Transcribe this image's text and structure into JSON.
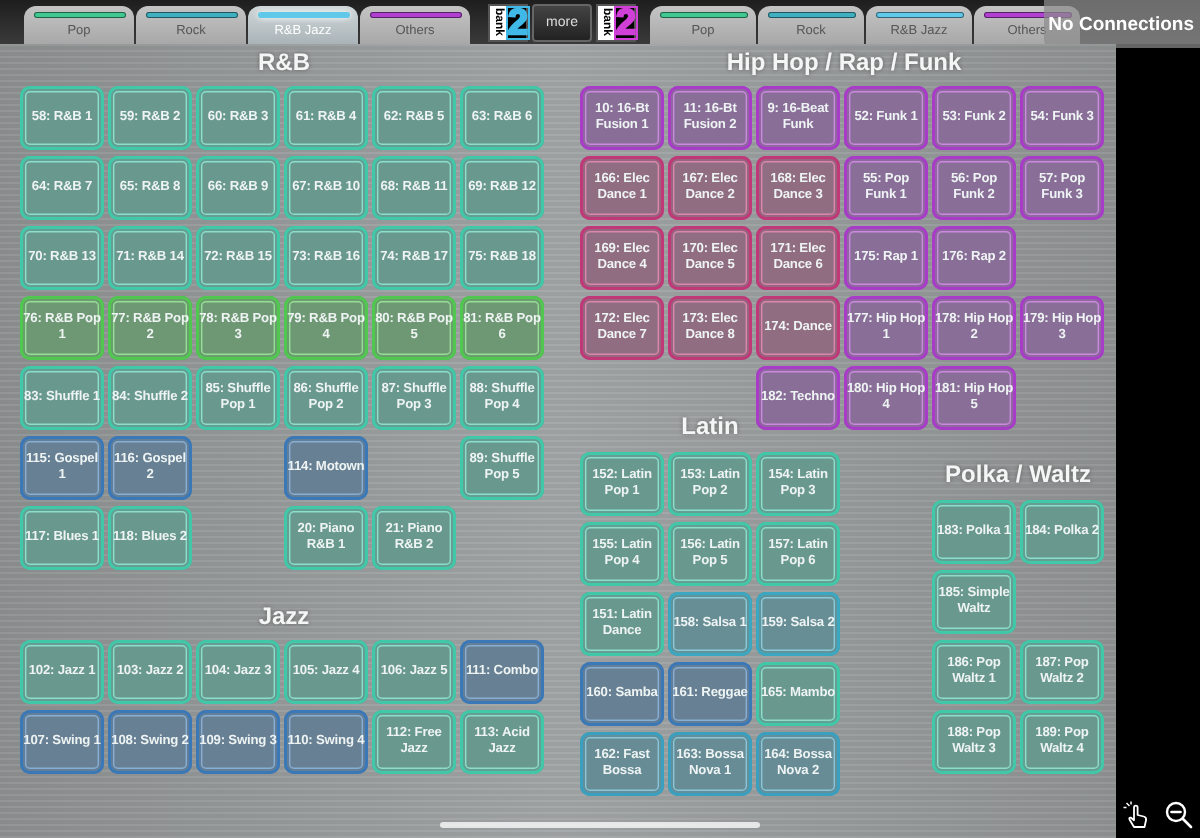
{
  "tabs_left": [
    {
      "label": "Pop",
      "color": "#40c890",
      "selected": false
    },
    {
      "label": "Rock",
      "color": "#40b0c0",
      "selected": false
    },
    {
      "label": "R&B Jazz",
      "color": "#60c8e8",
      "selected": true
    },
    {
      "label": "Others",
      "color": "#b040d0",
      "selected": false
    }
  ],
  "banks": [
    {
      "label": "bank",
      "number": "2",
      "color": "#40b8e8"
    },
    {
      "label": "bank",
      "number": "2",
      "color": "#d040d8"
    }
  ],
  "more_button": "more",
  "tabs_right": [
    {
      "label": "Pop",
      "color": "#40c890",
      "selected": false
    },
    {
      "label": "Rock",
      "color": "#40b0c0",
      "selected": false
    },
    {
      "label": "R&B Jazz",
      "color": "#60c8e8",
      "selected": false
    },
    {
      "label": "Others",
      "color": "#b040d0",
      "selected": false
    }
  ],
  "status": "No Connections",
  "left_panel": {
    "sections": [
      {
        "title": "R&B",
        "rows": [
          [
            {
              "label": "58: R&B 1",
              "color": "#40c8a8"
            },
            {
              "label": "59: R&B 2",
              "color": "#40c8a8"
            },
            {
              "label": "60: R&B 3",
              "color": "#40c8a8"
            },
            {
              "label": "61: R&B 4",
              "color": "#40c8a8"
            },
            {
              "label": "62: R&B 5",
              "color": "#40c8a8"
            },
            {
              "label": "63: R&B 6",
              "color": "#40c8a8"
            }
          ],
          [
            {
              "label": "64: R&B 7",
              "color": "#40c8a8"
            },
            {
              "label": "65: R&B 8",
              "color": "#40c8a8"
            },
            {
              "label": "66: R&B 9",
              "color": "#40c8a8"
            },
            {
              "label": "67: R&B 10",
              "color": "#40c8a8"
            },
            {
              "label": "68: R&B 11",
              "color": "#40c8a8"
            },
            {
              "label": "69: R&B 12",
              "color": "#40c8a8"
            }
          ],
          [
            {
              "label": "70: R&B 13",
              "color": "#40c8a8"
            },
            {
              "label": "71: R&B 14",
              "color": "#40c8a8"
            },
            {
              "label": "72: R&B 15",
              "color": "#40c8a8"
            },
            {
              "label": "73: R&B 16",
              "color": "#40c8a8"
            },
            {
              "label": "74: R&B 17",
              "color": "#40c8a8"
            },
            {
              "label": "75: R&B 18",
              "color": "#40c8a8"
            }
          ],
          [
            {
              "label": "76: R&B Pop 1",
              "color": "#50c850"
            },
            {
              "label": "77: R&B Pop 2",
              "color": "#50c850"
            },
            {
              "label": "78: R&B Pop 3",
              "color": "#50c850"
            },
            {
              "label": "79: R&B Pop 4",
              "color": "#50c850"
            },
            {
              "label": "80: R&B Pop 5",
              "color": "#50c850"
            },
            {
              "label": "81: R&B Pop 6",
              "color": "#50c850"
            }
          ],
          [
            {
              "label": "83: Shuffle 1",
              "color": "#40c8a8"
            },
            {
              "label": "84: Shuffle 2",
              "color": "#40c8a8"
            },
            {
              "label": "85: Shuffle Pop 1",
              "color": "#40c8a8"
            },
            {
              "label": "86: Shuffle Pop 2",
              "color": "#40c8a8"
            },
            {
              "label": "87: Shuffle Pop 3",
              "color": "#40c8a8"
            },
            {
              "label": "88: Shuffle Pop 4",
              "color": "#40c8a8"
            }
          ],
          [
            {
              "label": "115: Gospel 1",
              "color": "#3a78b8"
            },
            {
              "label": "116: Gospel 2",
              "color": "#3a78b8"
            },
            null,
            {
              "label": "114: Motown",
              "color": "#3a78b8"
            },
            null,
            {
              "label": "89: Shuffle Pop 5",
              "color": "#40c8a8"
            }
          ],
          [
            {
              "label": "117: Blues 1",
              "color": "#40c8a8"
            },
            {
              "label": "118: Blues 2",
              "color": "#40c8a8"
            },
            null,
            {
              "label": "20: Piano R&B 1",
              "color": "#40c8a8"
            },
            {
              "label": "21: Piano R&B 2",
              "color": "#40c8a8"
            },
            null
          ]
        ]
      },
      {
        "title": "Jazz",
        "rows": [
          [
            {
              "label": "102: Jazz 1",
              "color": "#40c8a8"
            },
            {
              "label": "103: Jazz 2",
              "color": "#40c8a8"
            },
            {
              "label": "104: Jazz 3",
              "color": "#40c8a8"
            },
            {
              "label": "105: Jazz 4",
              "color": "#40c8a8"
            },
            {
              "label": "106: Jazz 5",
              "color": "#40c8a8"
            },
            {
              "label": "111: Combo",
              "color": "#3a78b8"
            }
          ],
          [
            {
              "label": "107: Swing 1",
              "color": "#3a78b8"
            },
            {
              "label": "108: Swing 2",
              "color": "#3a78b8"
            },
            {
              "label": "109: Swing 3",
              "color": "#3a78b8"
            },
            {
              "label": "110: Swing 4",
              "color": "#3a78b8"
            },
            {
              "label": "112: Free Jazz",
              "color": "#40c8a8"
            },
            {
              "label": "113: Acid Jazz",
              "color": "#40c8a8"
            }
          ]
        ]
      }
    ]
  },
  "right_panel": {
    "sections": [
      {
        "title": "Hip Hop / Rap / Funk",
        "rows": [
          [
            {
              "label": "10: 16-Bt Fusion 1",
              "color": "#a83cc8"
            },
            {
              "label": "11: 16-Bt Fusion 2",
              "color": "#a83cc8"
            },
            {
              "label": "9: 16-Beat Funk",
              "color": "#a83cc8"
            },
            {
              "label": "52: Funk 1",
              "color": "#a83cc8"
            },
            {
              "label": "53: Funk 2",
              "color": "#a83cc8"
            },
            {
              "label": "54: Funk 3",
              "color": "#a83cc8"
            }
          ],
          [
            {
              "label": "166: Elec Dance 1",
              "color": "#c03878"
            },
            {
              "label": "167: Elec Dance 2",
              "color": "#c03878"
            },
            {
              "label": "168: Elec Dance 3",
              "color": "#c03878"
            },
            {
              "label": "55: Pop Funk 1",
              "color": "#a83cc8"
            },
            {
              "label": "56: Pop Funk 2",
              "color": "#a83cc8"
            },
            {
              "label": "57: Pop Funk 3",
              "color": "#a83cc8"
            }
          ],
          [
            {
              "label": "169: Elec Dance 4",
              "color": "#c03878"
            },
            {
              "label": "170: Elec Dance 5",
              "color": "#c03878"
            },
            {
              "label": "171: Elec Dance 6",
              "color": "#c03878"
            },
            {
              "label": "175: Rap 1",
              "color": "#a83cc8"
            },
            {
              "label": "176: Rap 2",
              "color": "#a83cc8"
            },
            null
          ],
          [
            {
              "label": "172: Elec Dance 7",
              "color": "#c03878"
            },
            {
              "label": "173: Elec Dance 8",
              "color": "#c03878"
            },
            {
              "label": "174: Dance",
              "color": "#c03878"
            },
            {
              "label": "177: Hip Hop 1",
              "color": "#a83cc8"
            },
            {
              "label": "178: Hip Hop 2",
              "color": "#a83cc8"
            },
            {
              "label": "179: Hip Hop 3",
              "color": "#a83cc8"
            }
          ],
          [
            null,
            null,
            {
              "label": "182: Techno",
              "color": "#a83cc8"
            },
            {
              "label": "180: Hip Hop 4",
              "color": "#a83cc8"
            },
            {
              "label": "181: Hip Hop 5",
              "color": "#a83cc8"
            },
            null
          ]
        ]
      },
      {
        "title": "Latin",
        "rows": [
          [
            {
              "label": "152: Latin Pop 1",
              "color": "#40c8a8"
            },
            {
              "label": "153: Latin Pop 2",
              "color": "#40c8a8"
            },
            {
              "label": "154: Latin Pop 3",
              "color": "#40c8a8"
            }
          ],
          [
            {
              "label": "155: Latin Pop 4",
              "color": "#40c8a8"
            },
            {
              "label": "156: Latin Pop 5",
              "color": "#40c8a8"
            },
            {
              "label": "157: Latin Pop 6",
              "color": "#40c8a8"
            }
          ],
          [
            {
              "label": "151: Latin Dance",
              "color": "#40c8a8"
            },
            {
              "label": "158: Salsa 1",
              "color": "#3aa8c0"
            },
            {
              "label": "159: Salsa 2",
              "color": "#3aa8c0"
            }
          ],
          [
            {
              "label": "160: Samba",
              "color": "#3a78b8"
            },
            {
              "label": "161: Reggae",
              "color": "#3a78b8"
            },
            {
              "label": "165: Mambo",
              "color": "#40c8a8"
            }
          ],
          [
            {
              "label": "162: Fast Bossa",
              "color": "#3aa0c0"
            },
            {
              "label": "163: Bossa Nova 1",
              "color": "#3aa0c0"
            },
            {
              "label": "164: Bossa Nova 2",
              "color": "#3aa0c0"
            }
          ]
        ]
      },
      {
        "title": "Polka / Waltz",
        "rows": [
          [
            {
              "label": "183: Polka 1",
              "color": "#40c8a8"
            },
            {
              "label": "184: Polka 2",
              "color": "#40c8a8"
            }
          ],
          [
            {
              "label": "185: Simple Waltz",
              "color": "#40c8a8"
            },
            null
          ],
          [
            {
              "label": "186: Pop Waltz 1",
              "color": "#40c8a8"
            },
            {
              "label": "187: Pop Waltz 2",
              "color": "#40c8a8"
            }
          ],
          [
            {
              "label": "188: Pop Waltz 3",
              "color": "#40c8a8"
            },
            {
              "label": "189: Pop Waltz 4",
              "color": "#40c8a8"
            }
          ]
        ]
      }
    ]
  }
}
